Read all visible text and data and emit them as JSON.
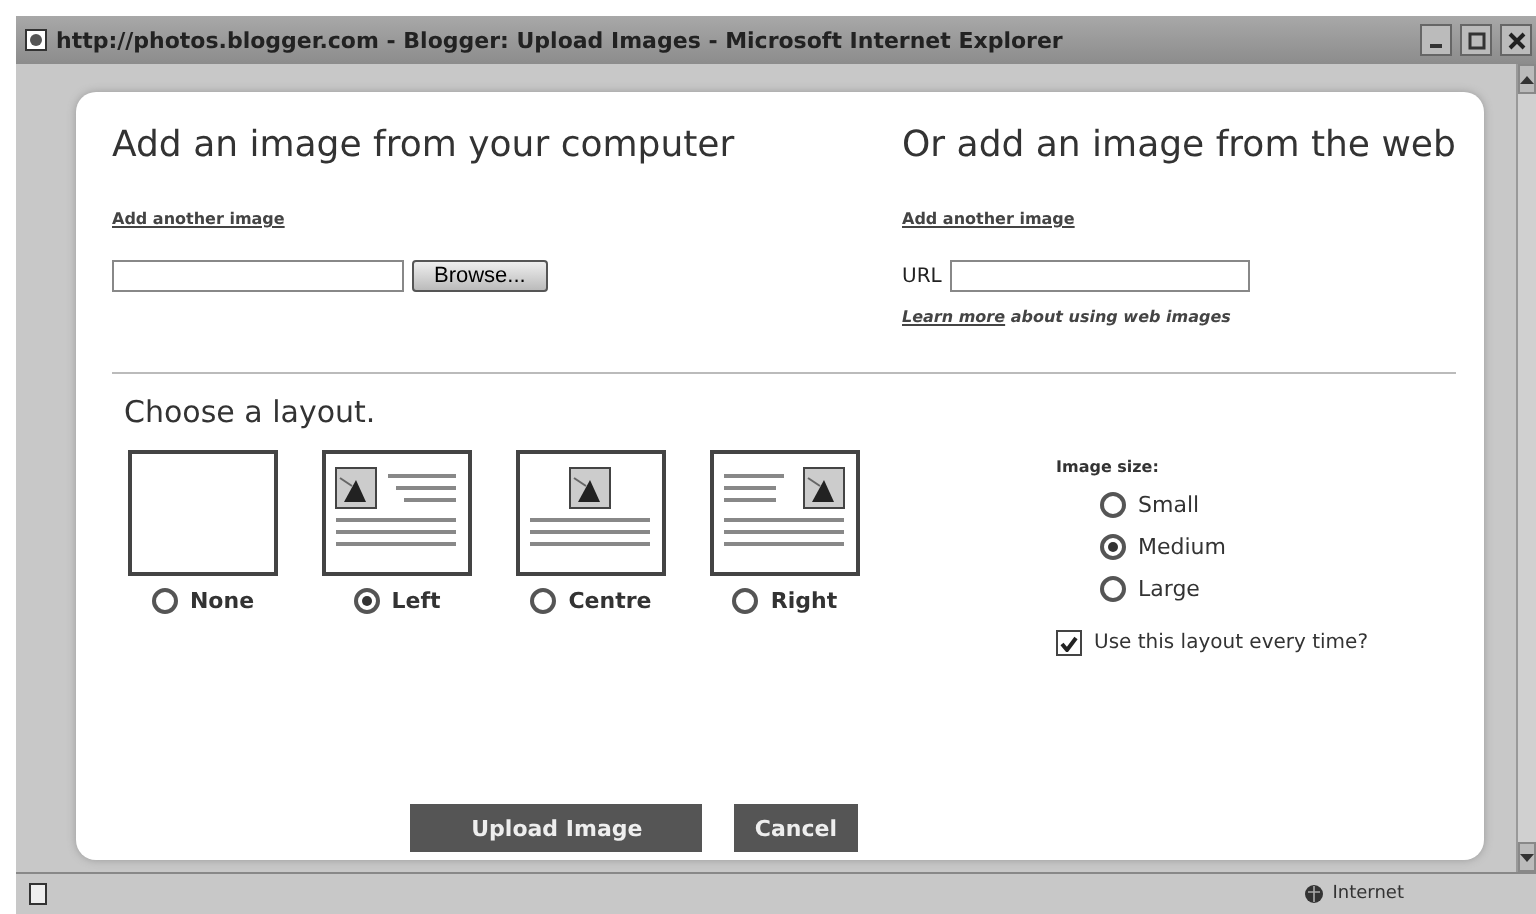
{
  "window": {
    "title": "http://photos.blogger.com - Blogger: Upload Images - Microsoft Internet Explorer"
  },
  "computer": {
    "heading": "Add an image from your computer",
    "add_link": "Add another image",
    "browse_button": "Browse..."
  },
  "web": {
    "heading": "Or add an image from the web",
    "add_link": "Add another image",
    "url_label": "URL",
    "learn_link": "Learn more",
    "learn_text": "about using web images"
  },
  "layout": {
    "heading": "Choose a layout.",
    "options": [
      {
        "label": "None",
        "kind": "none",
        "selected": false
      },
      {
        "label": "Left",
        "kind": "left",
        "selected": true
      },
      {
        "label": "Centre",
        "kind": "centre",
        "selected": false
      },
      {
        "label": "Right",
        "kind": "right",
        "selected": false
      }
    ]
  },
  "image_size": {
    "label": "Image size:",
    "options": [
      {
        "label": "Small",
        "selected": false
      },
      {
        "label": "Medium",
        "selected": true
      },
      {
        "label": "Large",
        "selected": false
      }
    ]
  },
  "remember": {
    "label": "Use this layout every time?",
    "checked": true
  },
  "buttons": {
    "upload": "Upload Image",
    "cancel": "Cancel"
  },
  "status_bar": {
    "zone": "Internet"
  }
}
